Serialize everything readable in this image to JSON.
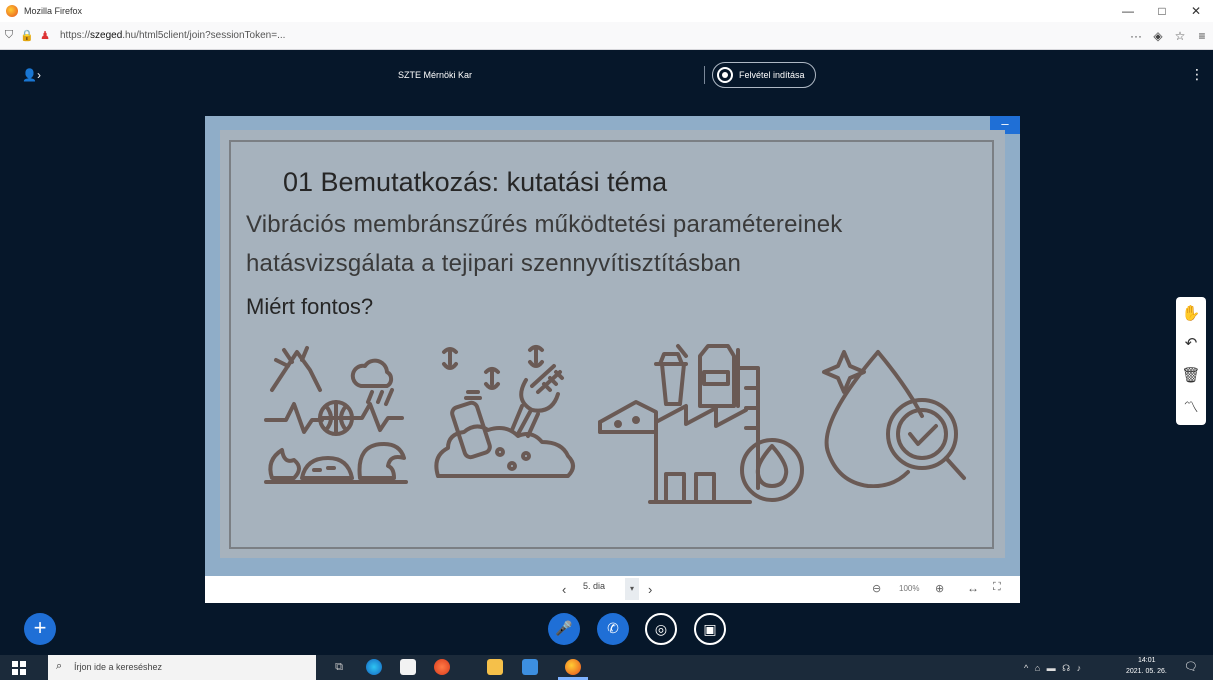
{
  "browser": {
    "title": "Mozilla Firefox",
    "url_prefix": "https://",
    "url_domain": "szeged",
    "url_suffix": ".hu/html5client/join?sessionToken=...",
    "buttons": {
      "minimize": "—",
      "maximize": "□",
      "close": "✕",
      "more": "···",
      "pocket": "◈",
      "bookmark": "☆",
      "menu": "≡"
    }
  },
  "header": {
    "users_toggle": "👤›",
    "meeting_title": "SZTE Mérnöki Kar",
    "recording_label": "Felvétel indítása",
    "options": "⋮"
  },
  "slide": {
    "title": "01 Bemutatkozás: kutatási téma",
    "subtitle_line1": "Vibrációs membránszűrés működtetési paramétereinek",
    "subtitle_line2": "hatásvizsgálata a tejipari szennyvítisztításban",
    "question": "Miért fontos?",
    "minimize": "–"
  },
  "presentation_toolbar": {
    "prev": "‹",
    "page": "5. dia",
    "caret": "▾",
    "next": "›",
    "zoom_out": "⊖",
    "zoom": "100%",
    "zoom_in": "⊕",
    "fit_width": "↔",
    "fullscreen": "⛶"
  },
  "whiteboard_tools": {
    "hand": "✋",
    "undo": "↶",
    "delete": "🗑",
    "multiuser": "〽"
  },
  "actions": {
    "plus": "+",
    "mic": "🎤",
    "phone": "✆",
    "camera": "◎",
    "screenshare": "▣"
  },
  "taskbar": {
    "search_placeholder": "Írjon ide a kereséshez",
    "search_icon": "⌕",
    "task_view": "⧉",
    "tray_icons": "^ ⌂ ▬ ☊ ♪",
    "time": "14:01",
    "date": "2021. 05. 26.",
    "notifications": "🗨"
  }
}
